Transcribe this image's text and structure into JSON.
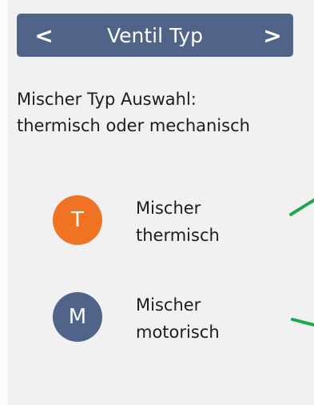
{
  "header": {
    "prev_glyph": "<",
    "title": "Ventil Typ",
    "next_glyph": ">"
  },
  "description": {
    "line1": "Mischer Typ Auswahl:",
    "line2": "thermisch oder mechanisch"
  },
  "options": [
    {
      "letter": "T",
      "line1": "Mischer",
      "line2": "thermisch",
      "color": "#ef7322",
      "icon": "letter-t-icon"
    },
    {
      "letter": "M",
      "line1": "Mischer",
      "line2": "motorisch",
      "color": "#4f6488",
      "icon": "letter-m-icon"
    }
  ],
  "colors": {
    "header_bg": "#4f6488",
    "panel_bg": "#f1f1f1",
    "pointer_line": "#1fa84a"
  }
}
